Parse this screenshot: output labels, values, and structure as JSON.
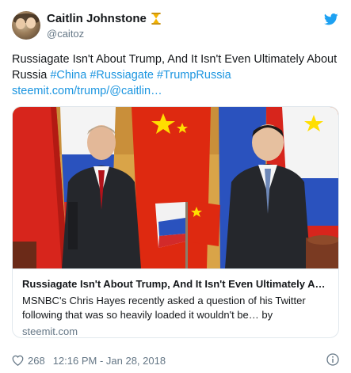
{
  "author": {
    "name": "Caitlin Johnstone",
    "handle": "@caitoz"
  },
  "tweet": {
    "text_plain": "Russiagate Isn't About Trump, And It Isn't Even Ultimately About Russia ",
    "hashtags": [
      "#China",
      "#Russiagate",
      "#TrumpRussia"
    ],
    "link": "steemit.com/trump/@caitlin…"
  },
  "card": {
    "title": "Russiagate Isn't About Trump, And It Isn't Even Ultimately Ab…",
    "description": "MSNBC's Chris Hayes recently asked a question of his Twitter following that was so heavily loaded it wouldn't be… by",
    "domain": "steemit.com"
  },
  "footer": {
    "likes": "268",
    "timestamp": "12:16 PM - Jan 28, 2018"
  },
  "icons": {
    "verified_emoji": "hourglass-icon",
    "platform": "twitter-bird-icon",
    "like": "heart-icon",
    "info": "info-icon"
  },
  "colors": {
    "link": "#1b95e0",
    "secondary": "#657786",
    "twitter_blue": "#1da1f2",
    "hourglass": "#f4b400"
  }
}
